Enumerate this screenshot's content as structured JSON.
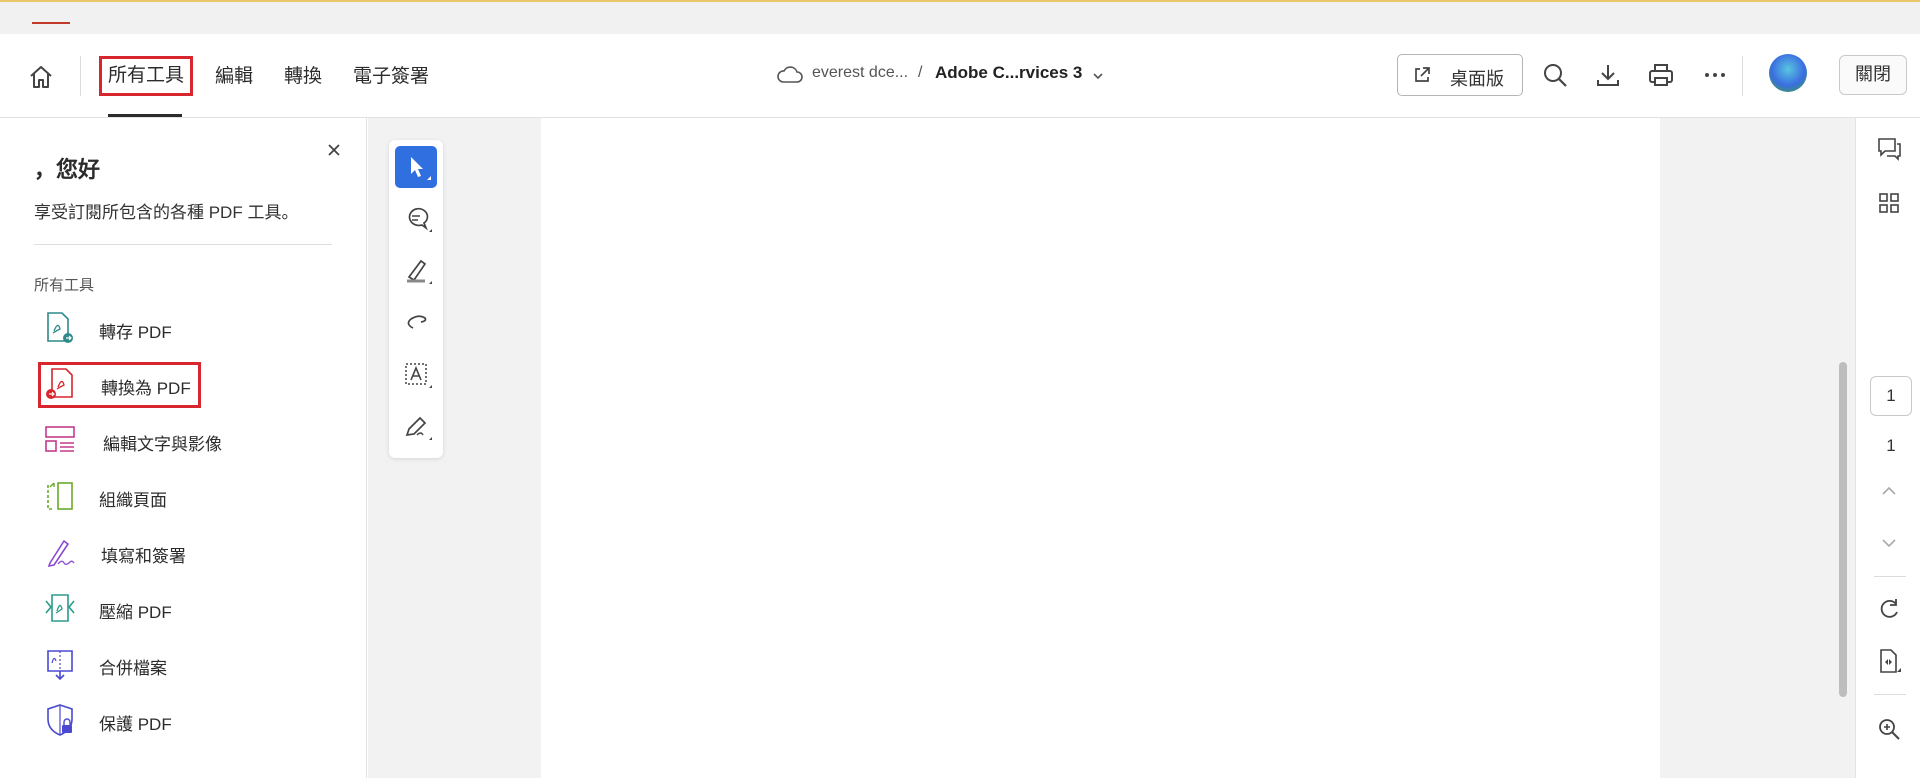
{
  "nav": {
    "tabs": [
      "所有工具",
      "編輯",
      "轉換",
      "電子簽署"
    ]
  },
  "breadcrumb": {
    "location": "everest dce...",
    "separator": "/",
    "document": "Adobe C...rvices 3"
  },
  "actions": {
    "desktop_label": "桌面版",
    "close_label": "關閉"
  },
  "sidebar": {
    "greeting": "，您好",
    "subtitle": "享受訂閱所包含的各種 PDF 工具。",
    "section_title": "所有工具",
    "items": [
      {
        "label": "轉存 PDF",
        "icon": "export-pdf-icon",
        "color": "#2f8a8a"
      },
      {
        "label": "轉換為 PDF",
        "icon": "create-pdf-icon",
        "color": "#d7262e"
      },
      {
        "label": "編輯文字與影像",
        "icon": "edit-text-image-icon",
        "color": "#c43a8a"
      },
      {
        "label": "組織頁面",
        "icon": "organize-pages-icon",
        "color": "#6aaa2a"
      },
      {
        "label": "填寫和簽署",
        "icon": "fill-sign-icon",
        "color": "#8a4ad0"
      },
      {
        "label": "壓縮 PDF",
        "icon": "compress-pdf-icon",
        "color": "#2a9a8a"
      },
      {
        "label": "合併檔案",
        "icon": "combine-files-icon",
        "color": "#4a4ad0"
      },
      {
        "label": "保護 PDF",
        "icon": "protect-pdf-icon",
        "color": "#4a4ad0"
      }
    ]
  },
  "page_nav": {
    "current": "1",
    "total": "1"
  },
  "colors": {
    "accent": "#2f6fe0",
    "highlight": "#d7262e"
  }
}
